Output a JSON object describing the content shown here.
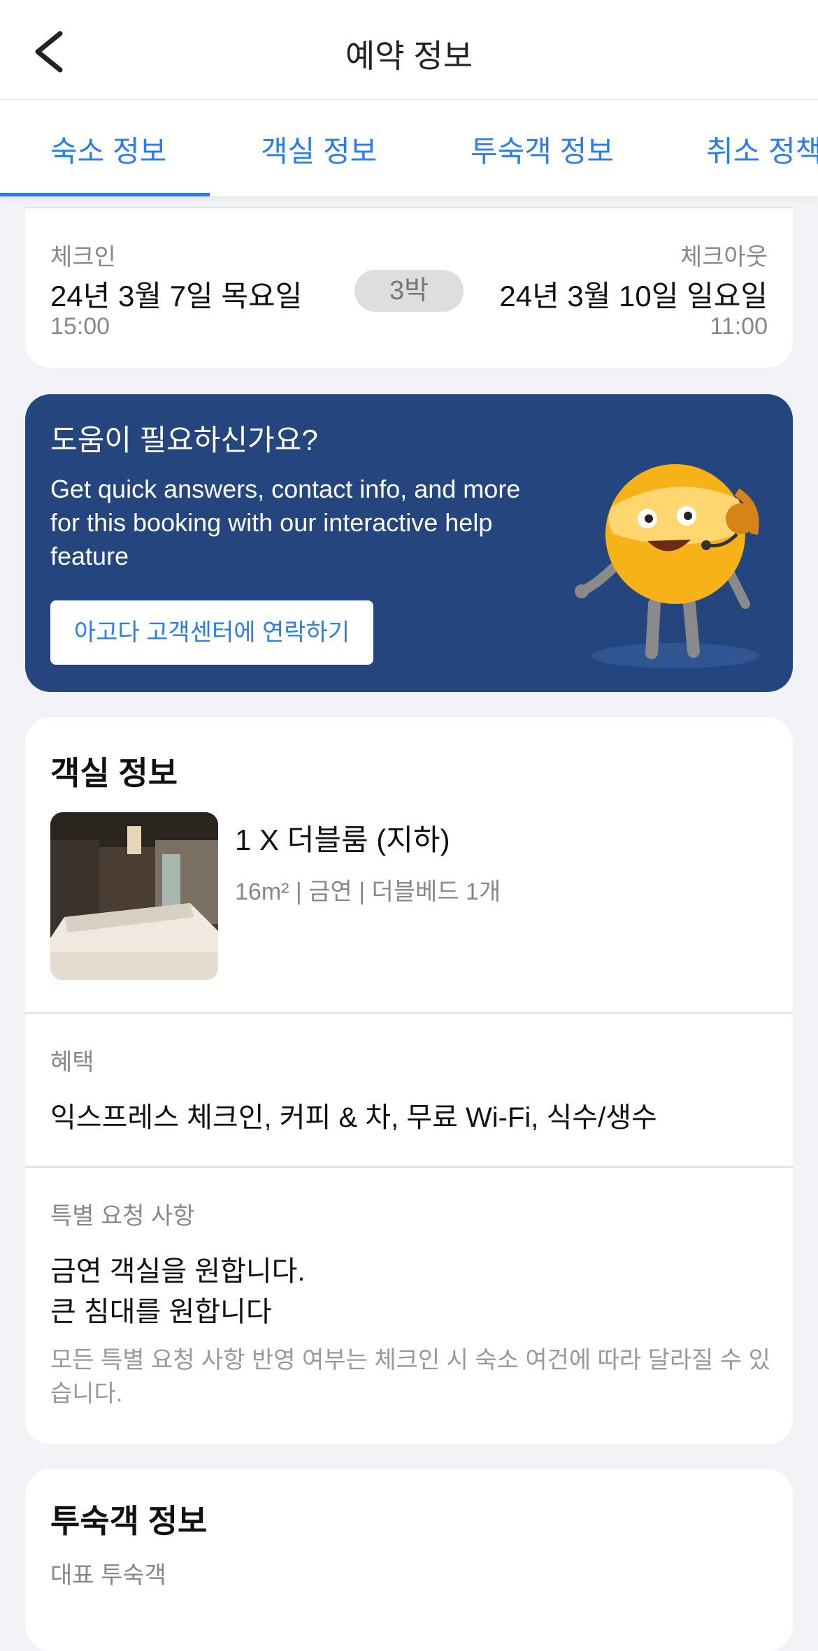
{
  "header": {
    "title": "예약 정보"
  },
  "tabs": [
    {
      "label": "숙소 정보"
    },
    {
      "label": "객실 정보"
    },
    {
      "label": "투숙객 정보"
    },
    {
      "label": "취소 정책"
    }
  ],
  "stay": {
    "checkin_label": "체크인",
    "checkin_date": "24년 3월 7일 목요일",
    "checkin_time": "15:00",
    "nights": "3박",
    "checkout_label": "체크아웃",
    "checkout_date": "24년 3월 10일 일요일",
    "checkout_time": "11:00"
  },
  "help": {
    "title": "도움이 필요하신가요?",
    "description": "Get quick answers, contact info, and more for this booking with our interactive help feature",
    "button_label": "아고다 고객센터에 연락하기"
  },
  "room": {
    "section_title": "객실 정보",
    "name": "1 X 더블룸 (지하)",
    "meta": "16m² | 금연 | 더블베드 1개",
    "benefits_label": "혜택",
    "benefits": "익스프레스 체크인, 커피 & 차, 무료 Wi-Fi, 식수/생수",
    "requests_label": "특별 요청 사항",
    "requests": [
      "금연 객실을 원합니다.",
      "큰 침대를 원합니다"
    ],
    "requests_note": "모든 특별 요청 사항 반영 여부는 체크인 시 숙소 여건에 따라 달라질 수 있습니다."
  },
  "guest": {
    "section_title": "투숙객 정보",
    "lead_guest_label": "대표 투숙객"
  },
  "colors": {
    "accent": "#2b7de9",
    "help_bg": "#24457d",
    "page_bg": "#f2f3f7"
  }
}
